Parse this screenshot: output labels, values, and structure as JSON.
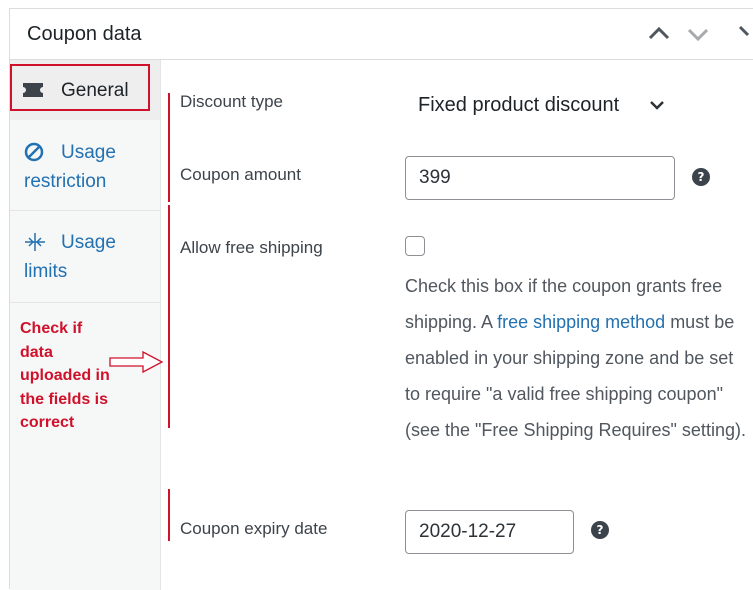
{
  "header": {
    "title": "Coupon data"
  },
  "sidebar": {
    "tabs": [
      {
        "label": "General",
        "icon": "ticket-icon"
      },
      {
        "label": "Usage restriction",
        "label_line1": "Usage",
        "label_line2": "restriction",
        "icon": "restricted-icon"
      },
      {
        "label": "Usage limits",
        "label_line1": "Usage",
        "label_line2": "limits",
        "icon": "limits-icon"
      }
    ]
  },
  "annotation": {
    "text_lines": [
      "Check if",
      "data",
      "uploaded in",
      "the fields is",
      "correct"
    ]
  },
  "fields": {
    "discount_type": {
      "label": "Discount type",
      "value": "Fixed product discount"
    },
    "coupon_amount": {
      "label": "Coupon amount",
      "value": "399",
      "help": "?"
    },
    "free_shipping": {
      "label": "Allow free shipping",
      "checked": false,
      "desc_before": "Check this box if the coupon grants free shipping. A ",
      "desc_link": "free shipping method",
      "desc_after": " must be enabled in your shipping zone and be set to require \"a valid free shipping coupon\" (see the \"Free Shipping Requires\" setting)."
    },
    "expiry_date": {
      "label": "Coupon expiry date",
      "value": "2020-12-27",
      "help": "?"
    }
  },
  "colors": {
    "accent_blue": "#2271b1",
    "annotation_red": "#d0112b",
    "sidebar_bg": "#f6f7f7"
  }
}
